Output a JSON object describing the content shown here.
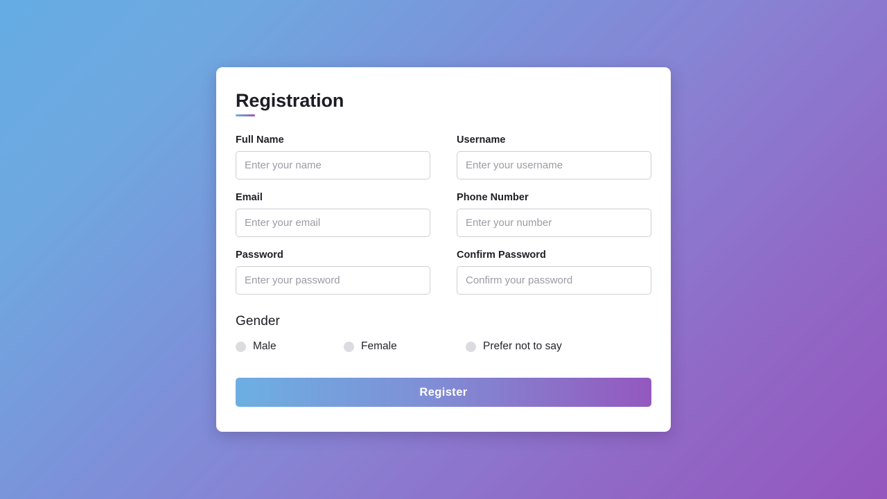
{
  "page": {
    "background_gradient_from": "#65ACE4",
    "background_gradient_to": "#9556BE"
  },
  "card": {
    "title": "Registration",
    "accent_color": "#9556BE"
  },
  "form": {
    "fields": [
      {
        "label": "Full Name",
        "placeholder": "Enter your name",
        "value": ""
      },
      {
        "label": "Username",
        "placeholder": "Enter your username",
        "value": ""
      },
      {
        "label": "Email",
        "placeholder": "Enter your email",
        "value": ""
      },
      {
        "label": "Phone Number",
        "placeholder": "Enter your number",
        "value": ""
      },
      {
        "label": "Password",
        "placeholder": "Enter your password",
        "value": ""
      },
      {
        "label": "Confirm Password",
        "placeholder": "Confirm your password",
        "value": ""
      }
    ]
  },
  "gender": {
    "title": "Gender",
    "options": [
      {
        "label": "Male",
        "selected": false
      },
      {
        "label": "Female",
        "selected": false
      },
      {
        "label": "Prefer not to say",
        "selected": false
      }
    ]
  },
  "submit": {
    "label": "Register",
    "gradient_from": "#6CAFE2",
    "gradient_to": "#9458BE"
  }
}
